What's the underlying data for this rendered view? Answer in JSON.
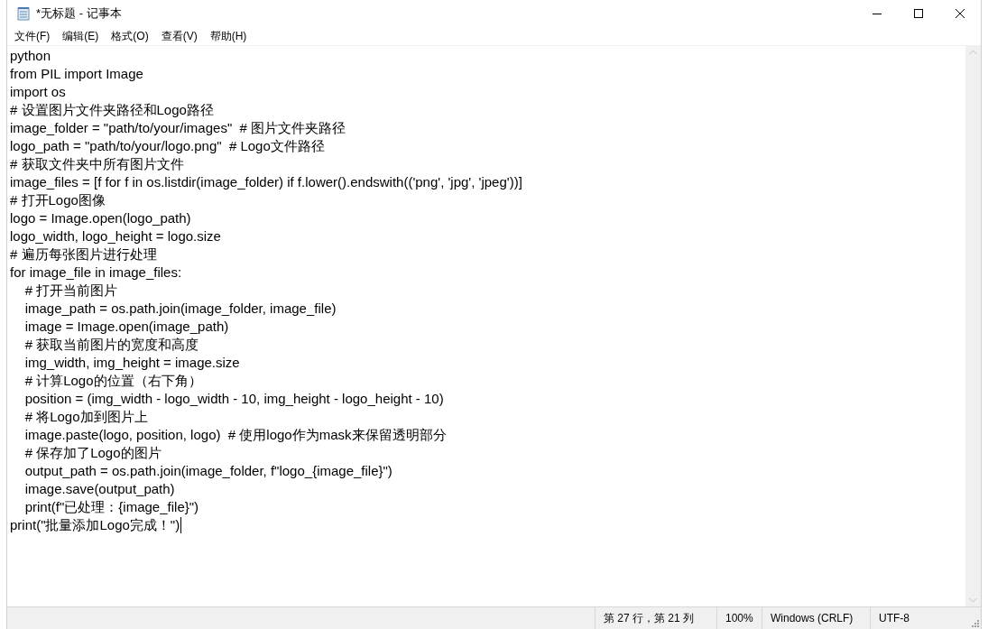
{
  "window": {
    "title": "*无标题 - 记事本"
  },
  "menu": [
    {
      "label": "文件(F)"
    },
    {
      "label": "编辑(E)"
    },
    {
      "label": "格式(O)"
    },
    {
      "label": "查看(V)"
    },
    {
      "label": "帮助(H)"
    }
  ],
  "editor": {
    "lines": [
      "python",
      "from PIL import Image",
      "import os",
      "# 设置图片文件夹路径和Logo路径",
      "image_folder = \"path/to/your/images\"  # 图片文件夹路径",
      "logo_path = \"path/to/your/logo.png\"  # Logo文件路径",
      "# 获取文件夹中所有图片文件",
      "image_files = [f for f in os.listdir(image_folder) if f.lower().endswith(('png', 'jpg', 'jpeg'))]",
      "# 打开Logo图像",
      "logo = Image.open(logo_path)",
      "logo_width, logo_height = logo.size",
      "# 遍历每张图片进行处理",
      "for image_file in image_files:",
      "    # 打开当前图片",
      "    image_path = os.path.join(image_folder, image_file)",
      "    image = Image.open(image_path)",
      "    # 获取当前图片的宽度和高度",
      "    img_width, img_height = image.size",
      "    # 计算Logo的位置（右下角）",
      "    position = (img_width - logo_width - 10, img_height - logo_height - 10)",
      "    # 将Logo加到图片上",
      "    image.paste(logo, position, logo)  # 使用logo作为mask来保留透明部分",
      "    # 保存加了Logo的图片",
      "    output_path = os.path.join(image_folder, f\"logo_{image_file}\")",
      "    image.save(output_path)",
      "    print(f\"已处理：{image_file}\")",
      "print(\"批量添加Logo完成！\")"
    ]
  },
  "status_bar": {
    "position": "第 27 行，第 21 列",
    "zoom": "100%",
    "line_ending": "Windows (CRLF)",
    "encoding": "UTF-8"
  }
}
